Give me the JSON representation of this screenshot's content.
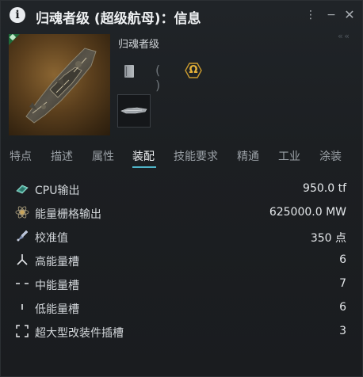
{
  "window": {
    "title": "归魂者级 (超级航母)：信息",
    "more_label": "⋮",
    "minimize_label": "−",
    "close_label": "✕",
    "collapse_label": "«  «"
  },
  "ship": {
    "name": "归魂者级",
    "omega_label": "Ω",
    "bracket_label": "( )"
  },
  "tabs": [
    {
      "label": "特点"
    },
    {
      "label": "描述"
    },
    {
      "label": "属性"
    },
    {
      "label": "装配"
    },
    {
      "label": "技能要求"
    },
    {
      "label": "精通"
    },
    {
      "label": "工业"
    },
    {
      "label": "涂装"
    }
  ],
  "active_tab": "装配",
  "attributes": [
    {
      "icon": "cpu-icon",
      "label": "CPU输出",
      "value": "950.0 tf"
    },
    {
      "icon": "powergrid-icon",
      "label": "能量栅格输出",
      "value": "625000.0 MW"
    },
    {
      "icon": "calibration-icon",
      "label": "校准值",
      "value": "350 点"
    },
    {
      "icon": "high-slot-icon",
      "label": "高能量槽",
      "value": "6"
    },
    {
      "icon": "mid-slot-icon",
      "label": "中能量槽",
      "value": "7"
    },
    {
      "icon": "low-slot-icon",
      "label": "低能量槽",
      "value": "6"
    },
    {
      "icon": "rig-slot-icon",
      "label": "超大型改装件插槽",
      "value": "3"
    }
  ],
  "colors": {
    "accent": "#4fb3c7",
    "omega": "#e6b33a",
    "tech_badge": "#1f6b3a"
  }
}
